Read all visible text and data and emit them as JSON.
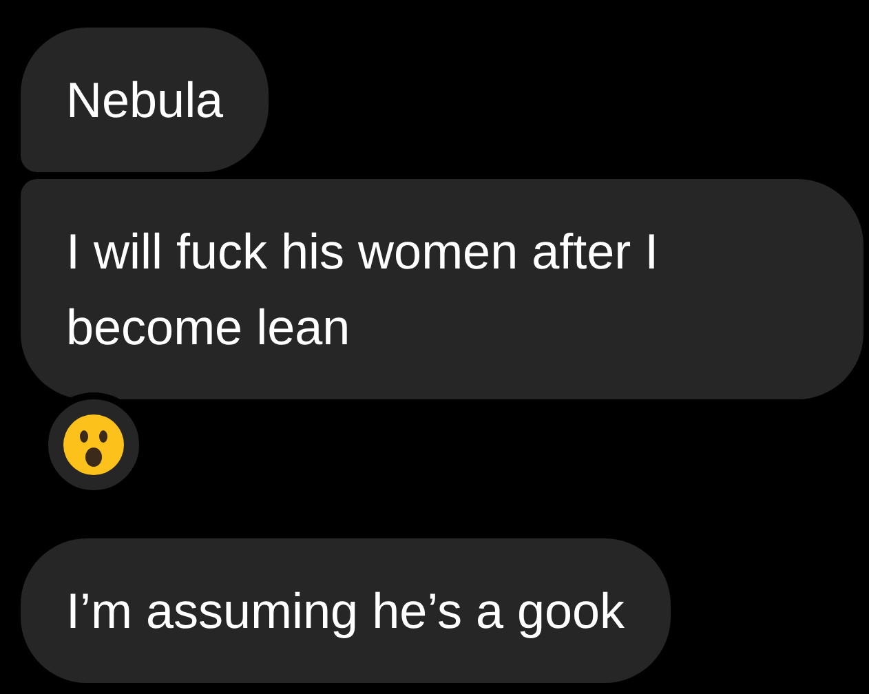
{
  "messages": [
    {
      "text": "Nebula",
      "kind": "first",
      "has_reaction": false
    },
    {
      "text": "I will fuck his women after I become lean",
      "kind": "last",
      "has_reaction": true
    },
    {
      "text": "I’m assuming he’s a gook",
      "kind": "single",
      "has_reaction": false
    }
  ]
}
